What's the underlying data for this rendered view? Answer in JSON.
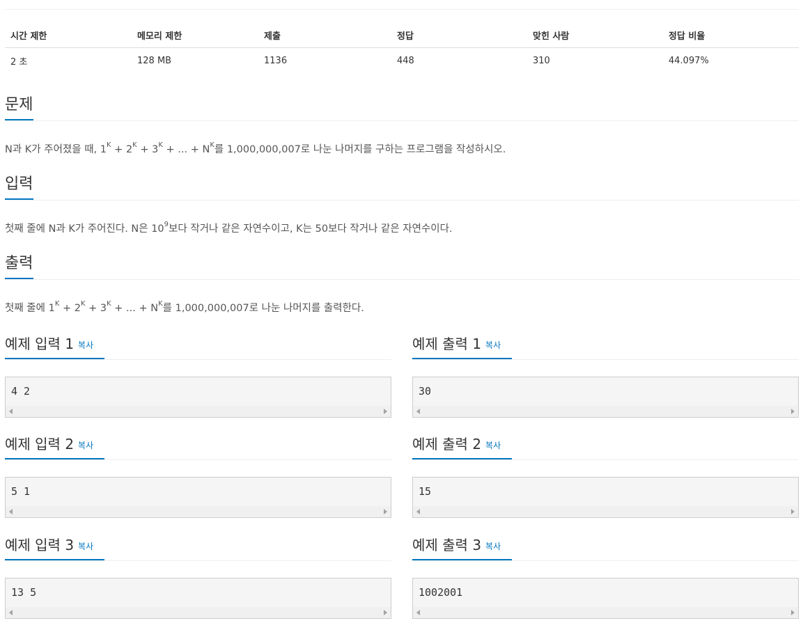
{
  "info": {
    "headers": [
      "시간 제한",
      "메모리 제한",
      "제출",
      "정답",
      "맞힌 사람",
      "정답 비율"
    ],
    "values": [
      "2 초",
      "128 MB",
      "1136",
      "448",
      "310",
      "44.097%"
    ]
  },
  "problem": {
    "title": "문제",
    "text": {
      "a": "N과 K가 주어졌을 때, 1",
      "sup1": "K",
      "b": " + 2",
      "sup2": "K",
      "c": " + 3",
      "sup3": "K",
      "d": " + ... + N",
      "sup4": "K",
      "e": "를 1,000,000,007로 나눈 나머지를 구하는 프로그램을 작성하시오."
    }
  },
  "input": {
    "title": "입력",
    "text": {
      "a": "첫째 줄에 N과 K가 주어진다. N은 10",
      "sup1": "9",
      "b": "보다 작거나 같은 자연수이고, K는 50보다 작거나 같은 자연수이다."
    }
  },
  "output": {
    "title": "출력",
    "text": {
      "a": "첫째 줄에 1",
      "sup1": "K",
      "b": " + 2",
      "sup2": "K",
      "c": " + 3",
      "sup3": "K",
      "d": " + ... + N",
      "sup4": "K",
      "e": "를 1,000,000,007로 나눈 나머지를 출력한다."
    }
  },
  "copy_label": "복사",
  "samples": [
    {
      "input_title": "예제 입력 1",
      "input": "4 2",
      "output_title": "예제 출력 1",
      "output": "30"
    },
    {
      "input_title": "예제 입력 2",
      "input": "5 1",
      "output_title": "예제 출력 2",
      "output": "15"
    },
    {
      "input_title": "예제 입력 3",
      "input": "13 5",
      "output_title": "예제 출력 3",
      "output": "1002001"
    }
  ]
}
